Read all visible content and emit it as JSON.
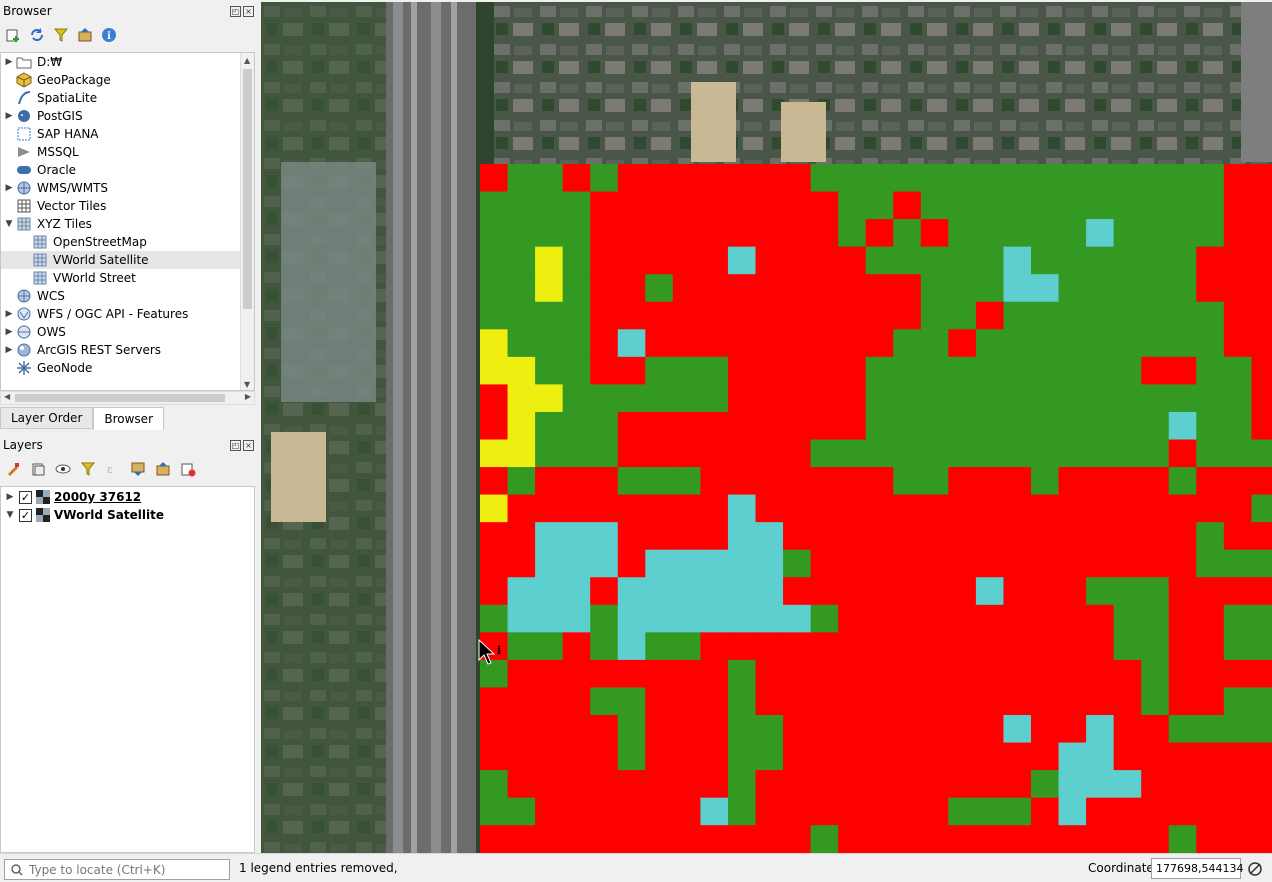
{
  "browser_panel": {
    "title": "Browser",
    "items": [
      {
        "label": "D:₩",
        "icon": "folder-icon",
        "expandable": true,
        "indent": 0
      },
      {
        "label": "GeoPackage",
        "icon": "geopackage-icon",
        "expandable": false,
        "indent": 0
      },
      {
        "label": "SpatiaLite",
        "icon": "spatialite-icon",
        "expandable": false,
        "indent": 0
      },
      {
        "label": "PostGIS",
        "icon": "postgis-icon",
        "expandable": true,
        "indent": 0
      },
      {
        "label": "SAP HANA",
        "icon": "sap-hana-icon",
        "expandable": false,
        "indent": 0
      },
      {
        "label": "MSSQL",
        "icon": "mssql-icon",
        "expandable": false,
        "indent": 0
      },
      {
        "label": "Oracle",
        "icon": "oracle-icon",
        "expandable": false,
        "indent": 0
      },
      {
        "label": "WMS/WMTS",
        "icon": "wms-icon",
        "expandable": true,
        "indent": 0
      },
      {
        "label": "Vector Tiles",
        "icon": "vector-tiles-icon",
        "expandable": false,
        "indent": 0
      },
      {
        "label": "XYZ Tiles",
        "icon": "xyz-tiles-icon",
        "expandable": true,
        "expanded": true,
        "indent": 0
      },
      {
        "label": "OpenStreetMap",
        "icon": "xyz-layer-icon",
        "expandable": false,
        "indent": 1
      },
      {
        "label": "VWorld Satellite",
        "icon": "xyz-layer-icon",
        "expandable": false,
        "indent": 1,
        "selected": true
      },
      {
        "label": "VWorld Street",
        "icon": "xyz-layer-icon",
        "expandable": false,
        "indent": 1
      },
      {
        "label": "WCS",
        "icon": "wcs-icon",
        "expandable": false,
        "indent": 0
      },
      {
        "label": "WFS / OGC API - Features",
        "icon": "wfs-icon",
        "expandable": true,
        "indent": 0
      },
      {
        "label": "OWS",
        "icon": "ows-icon",
        "expandable": true,
        "indent": 0
      },
      {
        "label": "ArcGIS REST Servers",
        "icon": "arcgis-icon",
        "expandable": true,
        "indent": 0
      },
      {
        "label": "GeoNode",
        "icon": "geonode-icon",
        "expandable": false,
        "indent": 0
      }
    ]
  },
  "tabs": {
    "layer_order": "Layer Order",
    "browser": "Browser"
  },
  "layers_panel": {
    "title": "Layers",
    "layers": [
      {
        "label": "2000y 37612",
        "checked": true,
        "expandable": true,
        "underline": true
      },
      {
        "label": "VWorld Satellite",
        "checked": true,
        "expandable": false
      }
    ]
  },
  "statusbar": {
    "search_placeholder": "Type to locate (Ctrl+K)",
    "message": "1 legend entries removed,",
    "coordinate_label": "Coordinate",
    "coordinate_value": "177698,544134"
  },
  "map": {
    "colors": {
      "red": "#ff0000",
      "green": "#339922",
      "cyan": "#5ecfcf",
      "yellow": "#eeee11"
    },
    "grid_rows": [
      "RGGRGRRRRRRRGGGGGGGGGGGGGGGRRRR",
      "GGGGRRRRRRRRRGGRGGGGGGGGGGGRRRR",
      "GGGGRRRRRRRRRGRGRGGGGGCGGGGRRRR",
      "GGYGRRRRRCRRRRGGGGGCGGGGGGRRRRR",
      "GGYGRRGRRRRRRRRRGGGCCGGGGGRRRRR",
      "GGGGRRRRRRRRRRRRGGRGGGGGGGGRRGR",
      "YGGGRCRRRRRRRRRGGRGGGGGGGGGRRGR",
      "YYGGRRGGGRRRRRGGGGGGGGGGRRGGRRR",
      "RYYGGGGGGRRRRRGGGGGGGGGGGGGGRRR",
      "RYGGGRRRRRRRRRGGGGGGGGGGGCGGRRR",
      "YYGGGRRRRRRRGGGGGGGGGGGGGRGGGRR",
      "RGRRRGGGRRRRRRRGGRRRGRRRRGRRRRR",
      "YRRRRRRRRCRRRRRRRRRRRRRRRRRRGGR",
      "RRCCCRRRRCCRRRRRRRRRRRRRRRGRRRR",
      "RRCCCRCCCCCGRRRRRRRRRRRRRRGGGRC",
      "RCCCRCCCCCCRRRRRRRCRRRGGGRRRRRR",
      "GCCCGCCCCCCCGRRRRRRRRRRGGRRGGRR",
      "RGGRGCGGRRRRRRRRRRRRRRRGGRRGGRG",
      "GRRRRRRRRGRRRRRRRRRRRRRRGRRRRRC",
      "RRRRGGRRRGRRRRRRRRRRRRRRGRRGGRR",
      "RRRRRGRRRGGRRRRRRRRCRRCRRGGGGGG",
      "RRRRRGRRRGGRRRRRRRRRRCCRRRRRRGG",
      "GRRRRRRRRGRRRRRRRRRRGCCCRRRRRRR",
      "GGRRRRRRCGRRRRRRRGGGRCRRRRRRRRR",
      "RRRRRRRRRRRRGRRRRRRRRRRRRGRRRGG"
    ]
  }
}
